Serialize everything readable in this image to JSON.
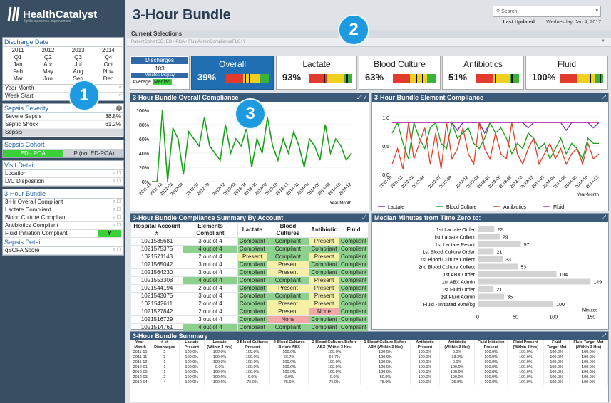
{
  "logo": {
    "name": "HealthCatalyst",
    "tagline": "Ignite outcomes improvement"
  },
  "sidebar": {
    "discharge_date": {
      "title": "Discharge Date",
      "years": [
        "2011",
        "2012",
        "2013",
        "2014"
      ],
      "quarters": [
        "Q1",
        "Q2",
        "Q3",
        "Q4"
      ],
      "months": [
        "Jan",
        "Apr",
        "Jul",
        "Oct",
        "Feb",
        "May",
        "Aug",
        "Nov",
        "Mar",
        "Jun",
        "Sep",
        "Dec"
      ],
      "year_month": "Year Month",
      "week_start": "Week Start"
    },
    "sepsis_severity": {
      "title": "Sepsis Severity",
      "rows": [
        {
          "label": "Severe Sepsis",
          "value": "38.8%"
        },
        {
          "label": "Septic Shock",
          "value": "61.2%"
        },
        {
          "label": "Sepsis",
          "value": ""
        }
      ]
    },
    "sepsis_cohort": {
      "title": "Sepsis Cohort",
      "opt1": "ED - POA",
      "opt2": "IP (not ED-POA)"
    },
    "visit_detail": {
      "title": "Visit Detail",
      "rows": [
        "Location",
        "D/C Disposition"
      ]
    },
    "bundle": {
      "title": "3-Hour Bundle",
      "rows": [
        "3-Hr Overall Compliant",
        "Lactate Compliant",
        "Blood Culture Compliant",
        "Antibiotics Compliant",
        "Fluid Initiation Compliant"
      ],
      "fluid_value": "Y"
    },
    "sepsis_detail": {
      "title": "Sepsis Detail",
      "rows": [
        "qSOFA Score"
      ]
    }
  },
  "header": {
    "title": "3-Hour Bundle",
    "search_placeholder": "Search",
    "last_updated_label": "Last Updated:",
    "last_updated": "Wednesday, Jan 4, 2017"
  },
  "current_selections": {
    "label": "Current Selections",
    "text": "PatientCohortCD: ED - POA • FluidAdminComplianceFLG: Y"
  },
  "discharges": {
    "label": "Discharges",
    "value": "183",
    "minutes_display": "Minutes Display",
    "average": "Average",
    "median": "Median"
  },
  "kpis": [
    {
      "name": "Overall",
      "value": "39%"
    },
    {
      "name": "Lactate",
      "value": "93%"
    },
    {
      "name": "Blood Culture",
      "value": "63%"
    },
    {
      "name": "Antibiotics",
      "value": "51%"
    },
    {
      "name": "Fluid",
      "value": "100%"
    }
  ],
  "panels": {
    "overall": "3-Hour Bundle Overall Compliance",
    "element": "3-Hour Bundle Element Compliance",
    "account": "3-Hour Bundle Compliance Summary By Account",
    "median": "Median Minutes from Time Zero to:",
    "summary": "3-Hour Bundle Summary"
  },
  "chart_data": [
    {
      "type": "line",
      "title": "3-Hour Bundle Overall Compliance",
      "xlabel": "Year-Month",
      "ylim": [
        0,
        100
      ],
      "yticks": [
        "100%",
        "80%",
        "60%",
        "40%",
        "20%",
        "0%"
      ],
      "x": [
        "2011-10",
        "2011-11",
        "2011-12",
        "2012-01",
        "2012-02",
        "2012-03",
        "2012-04",
        "2012-05",
        "2012-06",
        "2012-07",
        "2012-08",
        "2012-09",
        "2012-10",
        "2012-11",
        "2012-12",
        "2013-01",
        "2013-02",
        "2013-03",
        "2013-04",
        "2013-05",
        "2013-06",
        "2013-07",
        "2013-08",
        "2013-09",
        "2013-10",
        "2013-11",
        "2013-12",
        "2014-01",
        "2014-02",
        "2014-03",
        "2014-04",
        "2014-05",
        "2014-06",
        "2014-07",
        "2014-08",
        "2014-09",
        "2014-10",
        "2014-11",
        "2014-12"
      ],
      "xticks": [
        "2011-10",
        "2011-12",
        "2012-02",
        "2012-04",
        "2012-07",
        "2012-09",
        "2012-12",
        "2013-02",
        "2013-04",
        "2013-06",
        "2013-08",
        "2013-10",
        "2013-12",
        "2014-02",
        "2014-04",
        "2014-06",
        "2014-08",
        "2014-10",
        "2014-12"
      ],
      "series": [
        {
          "values": [
            0,
            0,
            100,
            0,
            75,
            60,
            10,
            70,
            60,
            50,
            90,
            50,
            40,
            30,
            80,
            40,
            60,
            50,
            75,
            20,
            60,
            40,
            90,
            50,
            30,
            60,
            40,
            70,
            50,
            20,
            60,
            50,
            30,
            80,
            40,
            60,
            50,
            30,
            40
          ],
          "color": "#1aa01a"
        }
      ]
    },
    {
      "type": "line",
      "title": "3-Hour Bundle Element Compliance",
      "xlabel": "Year-Month",
      "ylim": [
        0,
        1.1
      ],
      "yticks": [
        "1.0",
        "0.5",
        "0.0"
      ],
      "x": [
        "2011-10",
        "2011-11",
        "2011-12",
        "2012-01",
        "2012-02",
        "2012-03",
        "2012-04",
        "2012-05",
        "2012-06",
        "2012-07",
        "2012-08",
        "2012-09",
        "2012-10",
        "2012-11",
        "2012-12",
        "2013-01",
        "2013-02",
        "2013-03",
        "2013-04",
        "2013-05",
        "2013-06",
        "2013-07",
        "2013-08",
        "2013-09",
        "2013-10",
        "2013-11",
        "2013-12",
        "2014-01",
        "2014-02",
        "2014-03",
        "2014-04",
        "2014-05",
        "2014-06",
        "2014-07",
        "2014-08",
        "2014-09",
        "2014-10",
        "2014-11",
        "2014-12"
      ],
      "xticks": [
        "2011-10",
        "2011-12",
        "2012-02",
        "2012-04",
        "2012-07",
        "2012-09",
        "2012-12",
        "2013-02",
        "2013-04",
        "2013-06",
        "2013-08",
        "2013-10",
        "2013-12",
        "2014-02",
        "2014-04",
        "2014-06",
        "2014-08",
        "2014-10",
        "2014-12"
      ],
      "series": [
        {
          "name": "Lactate",
          "color": "#7b2fbe",
          "values": [
            1,
            1,
            1,
            1,
            1,
            1,
            1,
            1,
            1,
            1,
            1,
            1,
            0.85,
            1,
            1,
            1,
            1,
            0.8,
            1,
            1,
            1,
            1,
            1,
            1,
            1,
            0.9,
            1,
            1,
            1,
            1,
            1,
            1,
            0.85,
            1,
            1,
            1,
            1,
            0.9,
            1
          ]
        },
        {
          "name": "Blood Culture",
          "color": "#1aa01a",
          "values": [
            0.8,
            1,
            0.6,
            0.3,
            1,
            0.7,
            0.5,
            0.9,
            1,
            0.6,
            0.5,
            1,
            0.7,
            0.8,
            0.9,
            0.6,
            0.5,
            0.7,
            1,
            0.8,
            0.9,
            0.7,
            0.4,
            0.6,
            0.5,
            0.8,
            0.7,
            0.5,
            0.6,
            0.3,
            0.5,
            0.7,
            0.4,
            0.6,
            0.5,
            0.3,
            0.7,
            0.6,
            0.6
          ]
        },
        {
          "name": "Antibiotics",
          "color": "#e0402b",
          "values": [
            0.2,
            0.5,
            0.1,
            1,
            0.3,
            0.6,
            0.9,
            0.2,
            0.8,
            0.1,
            1,
            0.3,
            0.5,
            0.9,
            0.4,
            0.2,
            1,
            0.5,
            0.3,
            0.8,
            0.4,
            0.3,
            1,
            0.4,
            0.2,
            0.5,
            0.7,
            0.2,
            0.4,
            0.6,
            0.3,
            0.5,
            0.2,
            0.4,
            0.5,
            0.2,
            0.6,
            0.3,
            0.4
          ]
        },
        {
          "name": "Fluid",
          "color": "#c23fb5",
          "values": [
            1,
            1,
            1,
            1,
            1,
            1,
            1,
            1,
            1,
            1,
            1,
            1,
            1,
            1,
            1,
            1,
            1,
            1,
            1,
            1,
            1,
            1,
            1,
            1,
            1,
            1,
            1,
            1,
            1,
            1,
            1,
            1,
            1,
            1,
            1,
            1,
            1,
            1,
            1
          ]
        }
      ]
    },
    {
      "type": "bar",
      "title": "Median Minutes from Time Zero to:",
      "xlabel": "Minutes",
      "xlim": [
        0,
        160
      ],
      "xticks": [
        "0",
        "50",
        "100",
        "150"
      ],
      "categories": [
        "1st Lactate Order",
        "1st Lactate Collect",
        "1st Lactate Result",
        "1st Blood Culture Order",
        "1st Blood Culture Collect",
        "2nd Blood Culture Collect",
        "1st ABX Order",
        "1st ABX Admin",
        "1st Fluid Order",
        "1st Fluid Admin",
        "Fluid - Initiated 30ml/kg"
      ],
      "values": [
        22,
        29,
        57,
        21,
        33,
        53,
        104,
        149,
        21,
        35,
        100
      ]
    }
  ],
  "accounts": {
    "headers": [
      "Hospital Account #",
      "Elements Compliant",
      "Lactate",
      "Blood Cultures",
      "Antibiotic",
      "Fluid"
    ],
    "rows": [
      [
        "1021585681",
        "3 out of 4",
        "Compliant",
        "Compliant",
        "Present",
        "Compliant"
      ],
      [
        "1021575375",
        "4 out of 4",
        "Compliant",
        "Compliant",
        "Compliant",
        "Compliant"
      ],
      [
        "1021571143",
        "2 out of 4",
        "Present",
        "Compliant",
        "Present",
        "Compliant"
      ],
      [
        "1021565042",
        "3 out of 4",
        "Compliant",
        "Present",
        "Compliant",
        "Compliant"
      ],
      [
        "1021564230",
        "3 out of 4",
        "Compliant",
        "Present",
        "Compliant",
        "Compliant"
      ],
      [
        "1021553308",
        "4 out of 4",
        "Compliant",
        "Compliant",
        "Present",
        "Compliant"
      ],
      [
        "1021544194",
        "2 out of 4",
        "Compliant",
        "Present",
        "Present",
        "Compliant"
      ],
      [
        "1021543075",
        "3 out of 4",
        "Compliant",
        "Compliant",
        "Present",
        "Compliant"
      ],
      [
        "1021542611",
        "2 out of 4",
        "Compliant",
        "Present",
        "Present",
        "Compliant"
      ],
      [
        "1021527842",
        "2 out of 4",
        "Compliant",
        "Present",
        "None",
        "Compliant"
      ],
      [
        "1021516729",
        "3 out of 4",
        "Compliant",
        "None",
        "Compliant",
        "Compliant"
      ],
      [
        "1021514761",
        "4 out of 4",
        "Compliant",
        "Compliant",
        "Compliant",
        "Compliant"
      ]
    ]
  },
  "summary": {
    "headers": [
      "Year-Month",
      "# of Discharges",
      "Lactate Present",
      "Lactate (Within 3 Hrs)",
      "2 Blood Cultures Present",
      "2 Blood Cultures Before ABX",
      "2 Blood Cultures Before ABX (Within 3 Hrs)",
      "1 Blood Culture Before ABX (Within 3 Hrs)",
      "Antibiotic Present",
      "Antibiotic (Within 3 Hrs)",
      "Fluid Initiation Present",
      "Fluid Present (Within 3 Hrs)",
      "Fluid Target Met",
      "Fluid Target Met (Within 3 Hrs)"
    ],
    "rows": [
      [
        "2011-10",
        "2",
        "100.0%",
        "100.0%",
        "100.0%",
        "100.0%",
        "100.0%",
        "100.0%",
        "100.0%",
        "0.0%",
        "100.0%",
        "100.0%",
        "100.0%",
        "100.0%"
      ],
      [
        "2011-11",
        "3",
        "100.0%",
        "100.0%",
        "100.0%",
        "66.7%",
        "66.7%",
        "100.0%",
        "100.0%",
        "33.3%",
        "100.0%",
        "100.0%",
        "100.0%",
        "100.0%"
      ],
      [
        "2011-12",
        "1",
        "100.0%",
        "100.0%",
        "100.0%",
        "100.0%",
        "100.0%",
        "100.0%",
        "100.0%",
        "0.0%",
        "100.0%",
        "100.0%",
        "100.0%",
        "100.0%"
      ],
      [
        "2012-01",
        "1",
        "100.0%",
        "0.0%",
        "100.0%",
        "100.0%",
        "100.0%",
        "100.0%",
        "100.0%",
        "100.0%",
        "100.0%",
        "100.0%",
        "100.0%",
        "100.0%"
      ],
      [
        "2012-02",
        "1",
        "100.0%",
        "100.0%",
        "100.0%",
        "100.0%",
        "100.0%",
        "100.0%",
        "100.0%",
        "100.0%",
        "100.0%",
        "100.0%",
        "100.0%",
        "100.0%"
      ],
      [
        "2012-03",
        "2",
        "100.0%",
        "100.0%",
        "0.0%",
        "0.0%",
        "0.0%",
        "50.0%",
        "100.0%",
        "100.0%",
        "100.0%",
        "100.0%",
        "100.0%",
        "100.0%"
      ],
      [
        "2012-04",
        "4",
        "100.0%",
        "100.0%",
        "75.0%",
        "75.0%",
        "75.0%",
        "75.0%",
        "100.0%",
        "25.0%",
        "100.0%",
        "100.0%",
        "100.0%",
        "100.0%"
      ]
    ]
  },
  "badges": [
    "1",
    "2",
    "3"
  ],
  "colors": {
    "accent": "#1f6fb2",
    "header_dark": "#3b5a7a",
    "sidebar": "#3a4e63",
    "badge": "#1e9be0"
  }
}
